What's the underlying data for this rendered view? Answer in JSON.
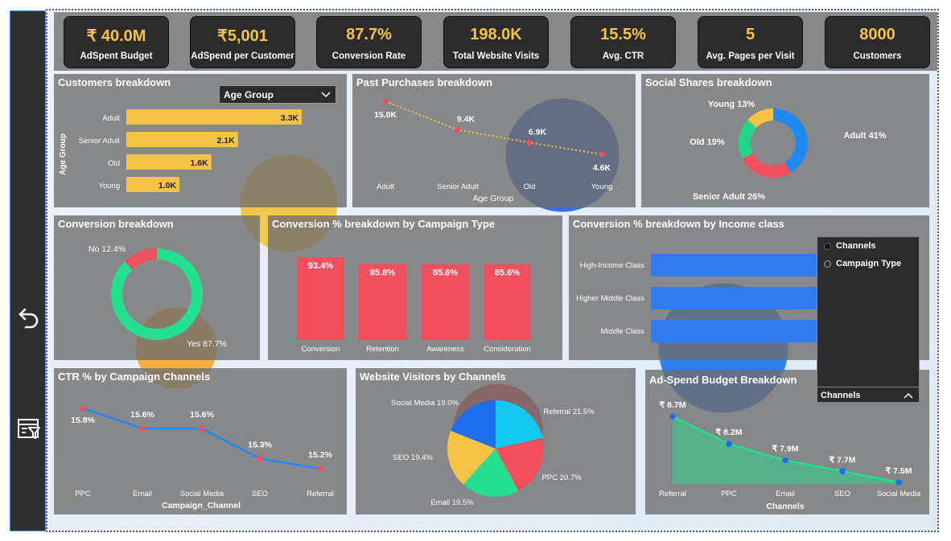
{
  "kpis": [
    {
      "value": "₹ 40.0M",
      "label": "AdSpent Budget"
    },
    {
      "value": "₹5,001",
      "label": "AdSpend per Customer"
    },
    {
      "value": "87.7%",
      "label": "Conversion Rate"
    },
    {
      "value": "198.0K",
      "label": "Total Website Visits"
    },
    {
      "value": "15.5%",
      "label": "Avg. CTR"
    },
    {
      "value": "5",
      "label": "Avg. Pages per Visit"
    },
    {
      "value": "8000",
      "label": "Customers"
    }
  ],
  "customers_breakdown": {
    "title": "Customers breakdown",
    "slicer_value": "Age Group",
    "ylabel": "Age Group",
    "categories": [
      "Adult",
      "Senior Adult",
      "Old",
      "Young"
    ],
    "values": [
      3.3,
      2.1,
      1.6,
      1.0
    ],
    "labels": [
      "3.3K",
      "2.1K",
      "1.6K",
      "1.0K"
    ],
    "color": "#f6c445"
  },
  "past_purchases": {
    "title": "Past Purchases breakdown",
    "xlabel": "Age Group",
    "categories": [
      "Adult",
      "Senior Adult",
      "Old",
      "Young"
    ],
    "values": [
      15.0,
      9.4,
      6.9,
      4.6
    ],
    "labels": [
      "15.0K",
      "9.4K",
      "6.9K",
      "4.6K"
    ]
  },
  "social_shares": {
    "title": "Social Shares breakdown",
    "slices": [
      {
        "label": "Adult 41%",
        "value": 41,
        "color": "#1e88f5"
      },
      {
        "label": "Senior Adult 26%",
        "value": 26,
        "color": "#f0505c"
      },
      {
        "label": "Old 19%",
        "value": 19,
        "color": "#22d58a"
      },
      {
        "label": "Young 13%",
        "value": 13,
        "color": "#f6c445"
      }
    ]
  },
  "conversion_breakdown": {
    "title": "Conversion breakdown",
    "slices": [
      {
        "label": "Yes 87.7%",
        "value": 87.7,
        "color": "#22e08f"
      },
      {
        "label": "No 12.4%",
        "value": 12.4,
        "color": "#f0505c"
      }
    ]
  },
  "conversion_by_campaign": {
    "title": "Conversion % breakdown by Campaign Type",
    "categories": [
      "Conversion",
      "Retention",
      "Awareness",
      "Consideration"
    ],
    "values": [
      93.4,
      85.8,
      85.6,
      85.6
    ],
    "labels": [
      "93.4%",
      "85.8%",
      "85.6%",
      "85.6%"
    ],
    "color": "#f0505c"
  },
  "conversion_by_income": {
    "title": "Conversion % breakdown by Income class",
    "categories": [
      "High-Income Class",
      "Higher Middle Class",
      "Middle Class"
    ],
    "color": "#2f7bf0"
  },
  "field_switch": {
    "options": [
      "Channels",
      "Campaign Type"
    ],
    "selected": "Channels"
  },
  "ctr_by_channel": {
    "title": "CTR % by Campaign Channels",
    "xlabel": "Campaign_Channel",
    "categories": [
      "PPC",
      "Email",
      "Social Media",
      "SEO",
      "Referral"
    ],
    "values": [
      15.8,
      15.6,
      15.6,
      15.3,
      15.2
    ],
    "labels": [
      "15.8%",
      "15.6%",
      "15.6%",
      "15.3%",
      "15.2%"
    ]
  },
  "visitors_by_channel": {
    "title": "Website Visitors by Channels",
    "slices": [
      {
        "label": "Referral 21.5%",
        "value": 21.5,
        "color": "#12c8ee"
      },
      {
        "label": "PPC 20.7%",
        "value": 20.7,
        "color": "#f0505c"
      },
      {
        "label": "Email 19.5%",
        "value": 19.5,
        "color": "#22e08f"
      },
      {
        "label": "SEO 19.4%",
        "value": 19.4,
        "color": "#f6c445"
      },
      {
        "label": "Social Media 19.0%",
        "value": 19.0,
        "color": "#1e6ff0"
      }
    ]
  },
  "adspend_breakdown": {
    "title": "Ad-Spend Budget Breakdown",
    "xlabel": "Channels",
    "categories": [
      "Referral",
      "PPC",
      "Email",
      "SEO",
      "Social Media"
    ],
    "values": [
      8.7,
      8.2,
      7.9,
      7.7,
      7.5
    ],
    "labels": [
      "₹ 8.7M",
      "₹ 8.2M",
      "₹ 7.9M",
      "₹ 7.7M",
      "₹ 7.5M"
    ]
  }
}
